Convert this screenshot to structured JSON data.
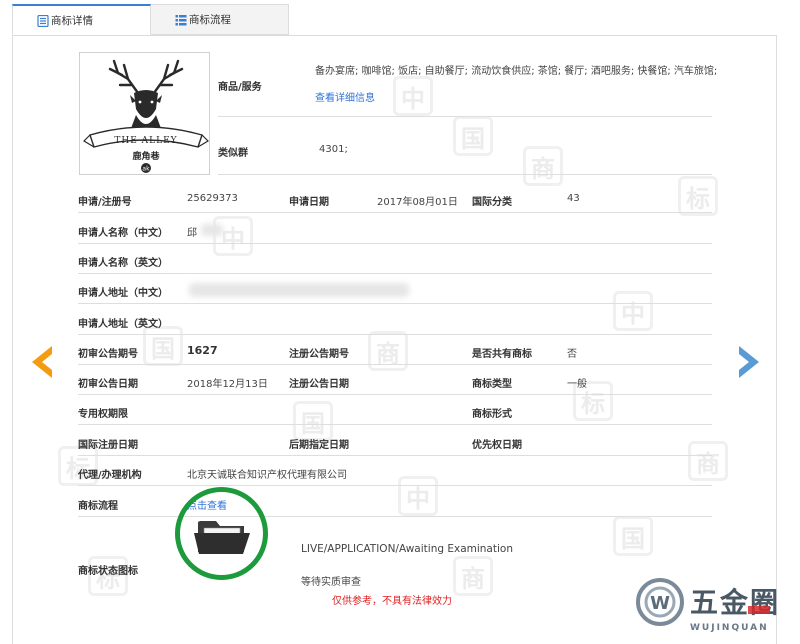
{
  "tabs": [
    {
      "label": "商标详情",
      "active": true
    },
    {
      "label": "商标流程",
      "active": false
    }
  ],
  "logo": {
    "brand_text": "THE ALLEY",
    "sub_text": "鹿角巷",
    "badge": "ak"
  },
  "goods": {
    "label": "商品/服务",
    "value": "备办宴席; 咖啡馆; 饭店; 自助餐厅; 流动饮食供应; 茶馆; 餐厅; 酒吧服务; 快餐馆; 汽车旅馆;",
    "link": "查看详细信息"
  },
  "similar_group": {
    "label": "类似群",
    "value": "4301;"
  },
  "fields": {
    "reg_no_label": "申请/注册号",
    "reg_no": "25629373",
    "apply_date_label": "申请日期",
    "apply_date": "2017年08月01日",
    "intl_class_label": "国际分类",
    "intl_class": "43",
    "applicant_cn_label": "申请人名称（中文）",
    "applicant_cn": "邱",
    "applicant_en_label": "申请人名称（英文）",
    "address_cn_label": "申请人地址（中文）",
    "address_en_label": "申请人地址（英文）",
    "prelim_no_label": "初审公告期号",
    "prelim_no": "1627",
    "reg_pub_no_label": "注册公告期号",
    "shared_label": "是否共有商标",
    "shared": "否",
    "prelim_date_label": "初审公告日期",
    "prelim_date": "2018年12月13日",
    "reg_pub_date_label": "注册公告日期",
    "tm_type_label": "商标类型",
    "tm_type": "一般",
    "exclusive_label": "专用权期限",
    "tm_form_label": "商标形式",
    "intl_reg_date_label": "国际注册日期",
    "later_date_label": "后期指定日期",
    "priority_date_label": "优先权日期",
    "agent_label": "代理/办理机构",
    "agent": "北京天诚联合知识产权代理有限公司",
    "flow_label": "商标流程",
    "flow_link": "点击查看",
    "status_icon_label": "商标状态图标",
    "status_en": "LIVE/APPLICATION/Awaiting Examination",
    "status_cn": "等待实质审查"
  },
  "disclaimer": "仅供参考，不具有法律效力",
  "site_logo": {
    "text": "五金圈",
    "sub": "WUJINQUAN"
  },
  "watermark_chars": [
    "中",
    "国",
    "商",
    "标"
  ],
  "colors": {
    "accent": "#3a7fd0",
    "link": "#2f72d6",
    "status_green": "#1c9a3c",
    "arrow_left": "#f39c12",
    "arrow_right": "#5b9bd5",
    "disclaimer": "#e02020"
  }
}
